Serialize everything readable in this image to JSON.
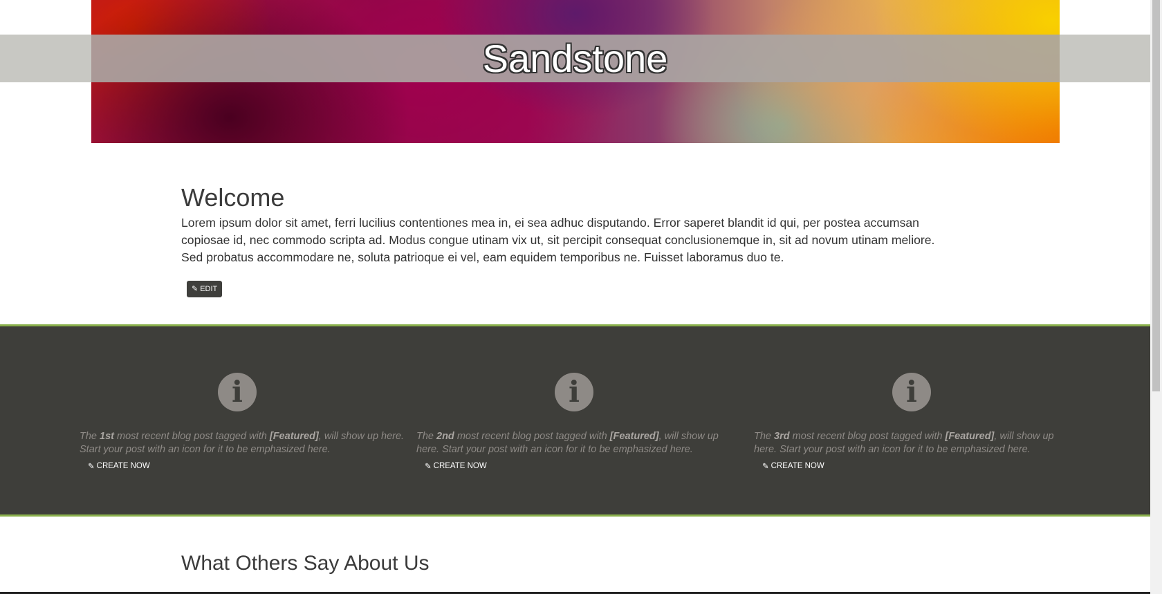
{
  "site": {
    "title": "Sandstone"
  },
  "welcome": {
    "heading": "Welcome",
    "body": "Lorem ipsum dolor sit amet, ferri lucilius contentiones mea in, ei sea adhuc disputando. Error saperet blandit id qui, per postea accumsan copiosae id, nec commodo scripta ad. Modus congue utinam vix ut, sit percipit consequat conclusionemque in, sit ad novum utinam meliore. Sed probatus accommodare ne, soluta patrioque ei vel, eam equidem temporibus ne. Fuisset laboramus duo te.",
    "edit_label": "EDIT"
  },
  "featured": {
    "items": [
      {
        "prefix": "The ",
        "rank": "1st",
        "middle": " most recent blog post tagged with ",
        "tag": "[Featured]",
        "suffix": ", will show up here. Start your post with an icon for it to be emphasized here.",
        "link": "CREATE NOW",
        "icon": "info-icon"
      },
      {
        "prefix": "The ",
        "rank": "2nd",
        "middle": " most recent blog post tagged with ",
        "tag": "[Featured]",
        "suffix": ", will show up here. Start your post with an icon for it to be emphasized here.",
        "link": "CREATE NOW",
        "icon": "info-icon"
      },
      {
        "prefix": "The ",
        "rank": "3rd",
        "middle": " most recent blog post tagged with ",
        "tag": "[Featured]",
        "suffix": ", will show up here. Start your post with an icon for it to be emphasized here.",
        "link": "CREATE NOW",
        "icon": "info-icon"
      }
    ]
  },
  "testimonials": {
    "heading": "What Others Say About Us"
  },
  "colors": {
    "accent": "#8ab04c",
    "dark_band": "#3e3e3a",
    "icon_grey": "#8e8a86"
  }
}
